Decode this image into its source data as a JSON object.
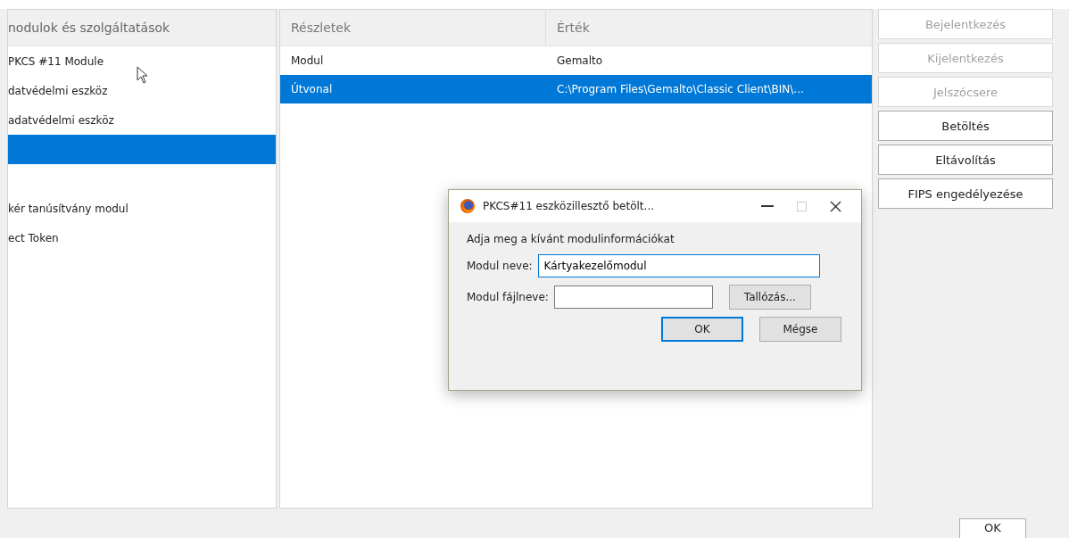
{
  "modules_tree": {
    "header": "nodulok és szolgáltatások",
    "items": [
      {
        "label": "PKCS #11 Module",
        "selected": false
      },
      {
        "label": "datvédelmi eszköz",
        "selected": false
      },
      {
        "label": "adatvédelmi eszköz",
        "selected": false
      },
      {
        "selected": true
      },
      {
        "selected": false
      },
      {
        "label": "kér tanúsítvány modul",
        "selected": false
      },
      {
        "label": "ect Token",
        "selected": false
      }
    ]
  },
  "details_table": {
    "columns": [
      "Részletek",
      "Érték"
    ],
    "rows": [
      {
        "cells": [
          "Modul",
          "Gemalto"
        ],
        "selected": false
      },
      {
        "cells": [
          "Útvonal",
          "C:\\Program Files\\Gemalto\\Classic Client\\BIN\\..."
        ],
        "selected": true
      }
    ]
  },
  "side_buttons": [
    {
      "label": "Bejelentkezés",
      "disabled": true
    },
    {
      "label": "Kijelentkezés",
      "disabled": true
    },
    {
      "label": "Jelszócsere",
      "disabled": true
    },
    {
      "label": "Betöltés",
      "disabled": false
    },
    {
      "label": "Eltávolítás",
      "disabled": false
    },
    {
      "label": "FIPS engedélyezése",
      "disabled": false
    }
  ],
  "dialog": {
    "title": "PKCS#11 eszközillesztő betölt...",
    "prompt": "Adja meg a kívánt modulinformációkat",
    "fields": [
      {
        "label": "Modul neve:",
        "value": "Kártyakezelőmodul",
        "focused": true
      },
      {
        "label": "Modul fájlneve:",
        "focused": false,
        "button": "Tallózás..."
      }
    ],
    "buttons": [
      {
        "label": "OK",
        "default": true
      },
      {
        "label": "Mégse",
        "default": false
      }
    ]
  },
  "footer_button": "OK"
}
